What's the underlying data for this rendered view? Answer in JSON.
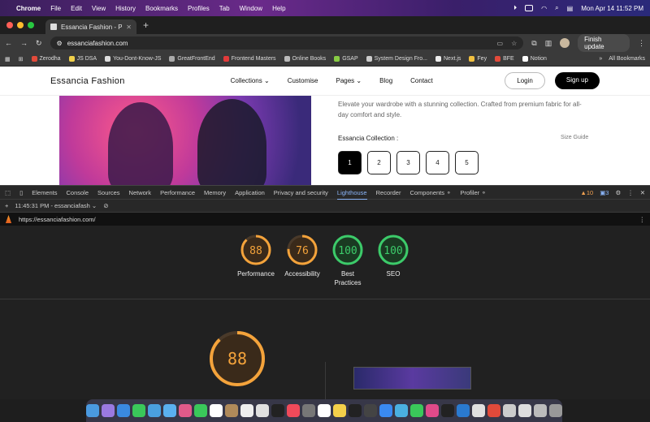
{
  "menubar": {
    "app": "Chrome",
    "items": [
      "File",
      "Edit",
      "View",
      "History",
      "Bookmarks",
      "Profiles",
      "Tab",
      "Window",
      "Help"
    ],
    "datetime": "Mon Apr 14  11:52 PM"
  },
  "browser": {
    "tab_title": "Essancia Fashion - Premium",
    "url": "essanciafashion.com",
    "finish_update": "Finish update",
    "bookmarks": [
      "Zerodha",
      "JS DSA",
      "You-Dont-Know-JS",
      "GreatFrontEnd",
      "Frontend Masters",
      "Online Books",
      "GSAP",
      "System Design Fro...",
      "Next.js",
      "Fey",
      "BFE",
      "Notion"
    ],
    "all_bookmarks": "All Bookmarks"
  },
  "site": {
    "brand": "Essancia Fashion",
    "nav": [
      "Collections",
      "Customise",
      "Pages",
      "Blog",
      "Contact"
    ],
    "login": "Login",
    "signup": "Sign up",
    "description": "Elevate your wardrobe with a stunning collection. Crafted from premium fabric for all-day comfort and style.",
    "collection_label": "Essancia Collection :",
    "size_guide": "Size Guide",
    "sizes": [
      "1",
      "2",
      "3",
      "4",
      "5"
    ]
  },
  "devtools": {
    "tabs": [
      "Elements",
      "Console",
      "Sources",
      "Network",
      "Performance",
      "Memory",
      "Application",
      "Privacy and security",
      "Lighthouse",
      "Recorder",
      "Components",
      "Profiler"
    ],
    "active_tab": "Lighthouse",
    "warnings": "10",
    "messages": "3",
    "session": "11:45:31 PM - essanciafash",
    "report_url": "https://essanciafashion.com/"
  },
  "lighthouse": {
    "scores": [
      {
        "label": "Performance",
        "value": 88,
        "color": "#f4a33b"
      },
      {
        "label": "Accessibility",
        "value": 76,
        "color": "#f4a33b"
      },
      {
        "label": "Best Practices",
        "value": 100,
        "color": "#3ccb6a"
      },
      {
        "label": "SEO",
        "value": 100,
        "color": "#3ccb6a"
      }
    ],
    "main_score": 88
  }
}
